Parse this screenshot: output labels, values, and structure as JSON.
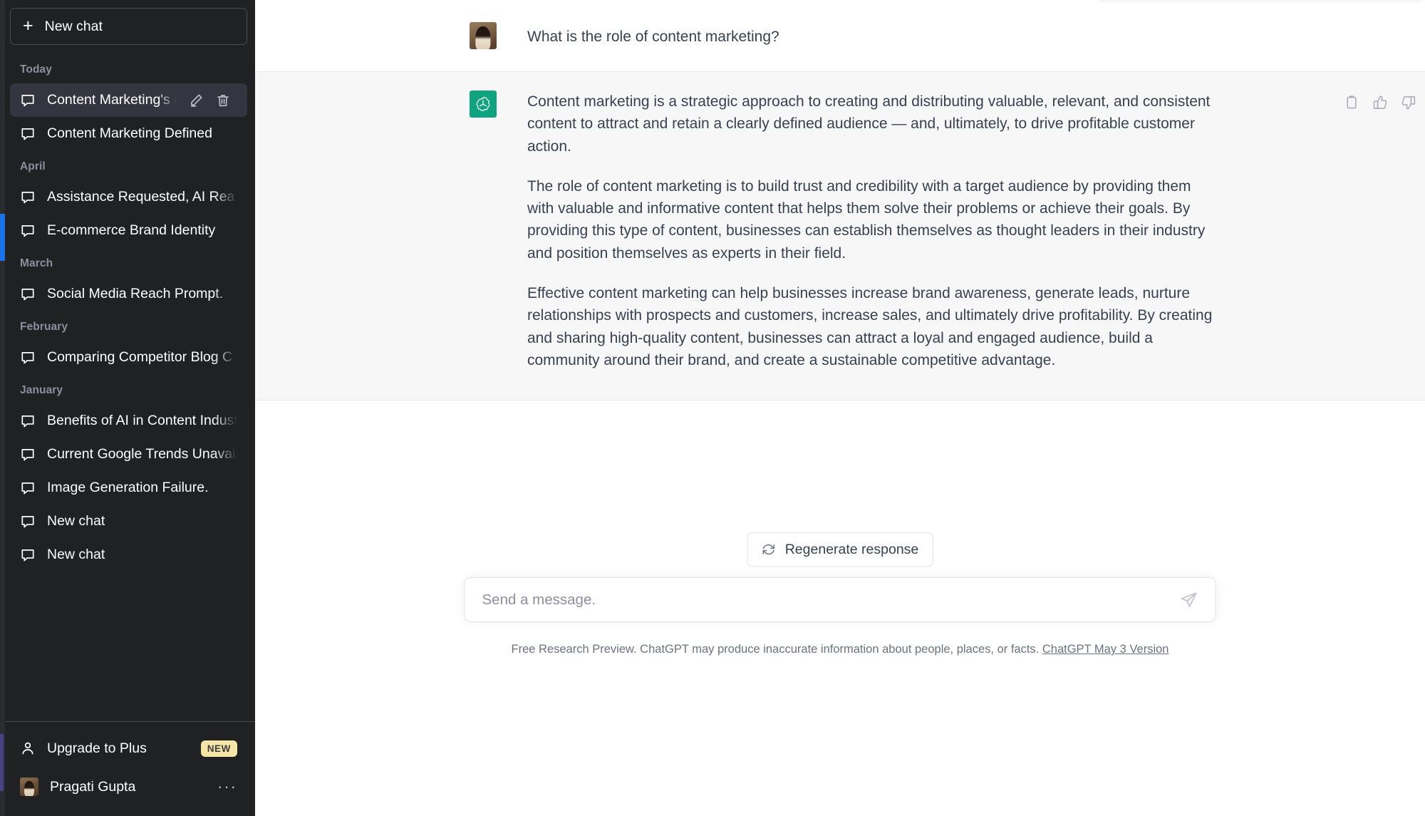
{
  "sidebar": {
    "new_chat_label": "New chat",
    "groups": [
      {
        "label": "Today",
        "items": [
          {
            "title": "Content Marketing's Ro",
            "active": true
          },
          {
            "title": "Content Marketing Defined",
            "active": false
          }
        ]
      },
      {
        "label": "April",
        "items": [
          {
            "title": "Assistance Requested, AI Rea",
            "active": false
          },
          {
            "title": "E-commerce Brand Identity",
            "active": false
          }
        ]
      },
      {
        "label": "March",
        "items": [
          {
            "title": "Social Media Reach Prompt.",
            "active": false
          }
        ]
      },
      {
        "label": "February",
        "items": [
          {
            "title": "Comparing Competitor Blog C",
            "active": false
          }
        ]
      },
      {
        "label": "January",
        "items": [
          {
            "title": "Benefits of AI in Content Indust",
            "active": false
          },
          {
            "title": "Current Google Trends Unavail",
            "active": false
          },
          {
            "title": "Image Generation Failure.",
            "active": false
          },
          {
            "title": "New chat",
            "active": false
          },
          {
            "title": "New chat",
            "active": false
          }
        ]
      }
    ],
    "upgrade_label": "Upgrade to Plus",
    "upgrade_badge": "NEW",
    "user_name": "Pragati Gupta",
    "user_more": "···"
  },
  "conversation": {
    "messages": [
      {
        "role": "user",
        "paragraphs": [
          "What is the role of content marketing?"
        ]
      },
      {
        "role": "assistant",
        "paragraphs": [
          "Content marketing is a strategic approach to creating and distributing valuable, relevant, and consistent content to attract and retain a clearly defined audience — and, ultimately, to drive profitable customer action.",
          "The role of content marketing is to build trust and credibility with a target audience by providing them with valuable and informative content that helps them solve their problems or achieve their goals. By providing this type of content, businesses can establish themselves as thought leaders in their industry and position themselves as experts in their field.",
          "Effective content marketing can help businesses increase brand awareness, generate leads, nurture relationships with prospects and customers, increase sales, and ultimately drive profitability. By creating and sharing high-quality content, businesses can attract a loyal and engaged audience, build a community around their brand, and create a sustainable competitive advantage."
        ]
      }
    ]
  },
  "composer": {
    "regenerate_label": "Regenerate response",
    "input_value": "",
    "input_placeholder": "Send a message.",
    "disclaimer_text": "Free Research Preview. ChatGPT may produce inaccurate information about people, places, or facts.",
    "version_link": "ChatGPT May 3 Version"
  },
  "colors": {
    "sidebar_bg": "#202123",
    "sidebar_active": "#343541",
    "brand_green": "#10a37f",
    "assistant_bg": "#f7f7f8",
    "badge_yellow": "#f5e6a8",
    "scrollbar_blue": "#1a73e8"
  }
}
